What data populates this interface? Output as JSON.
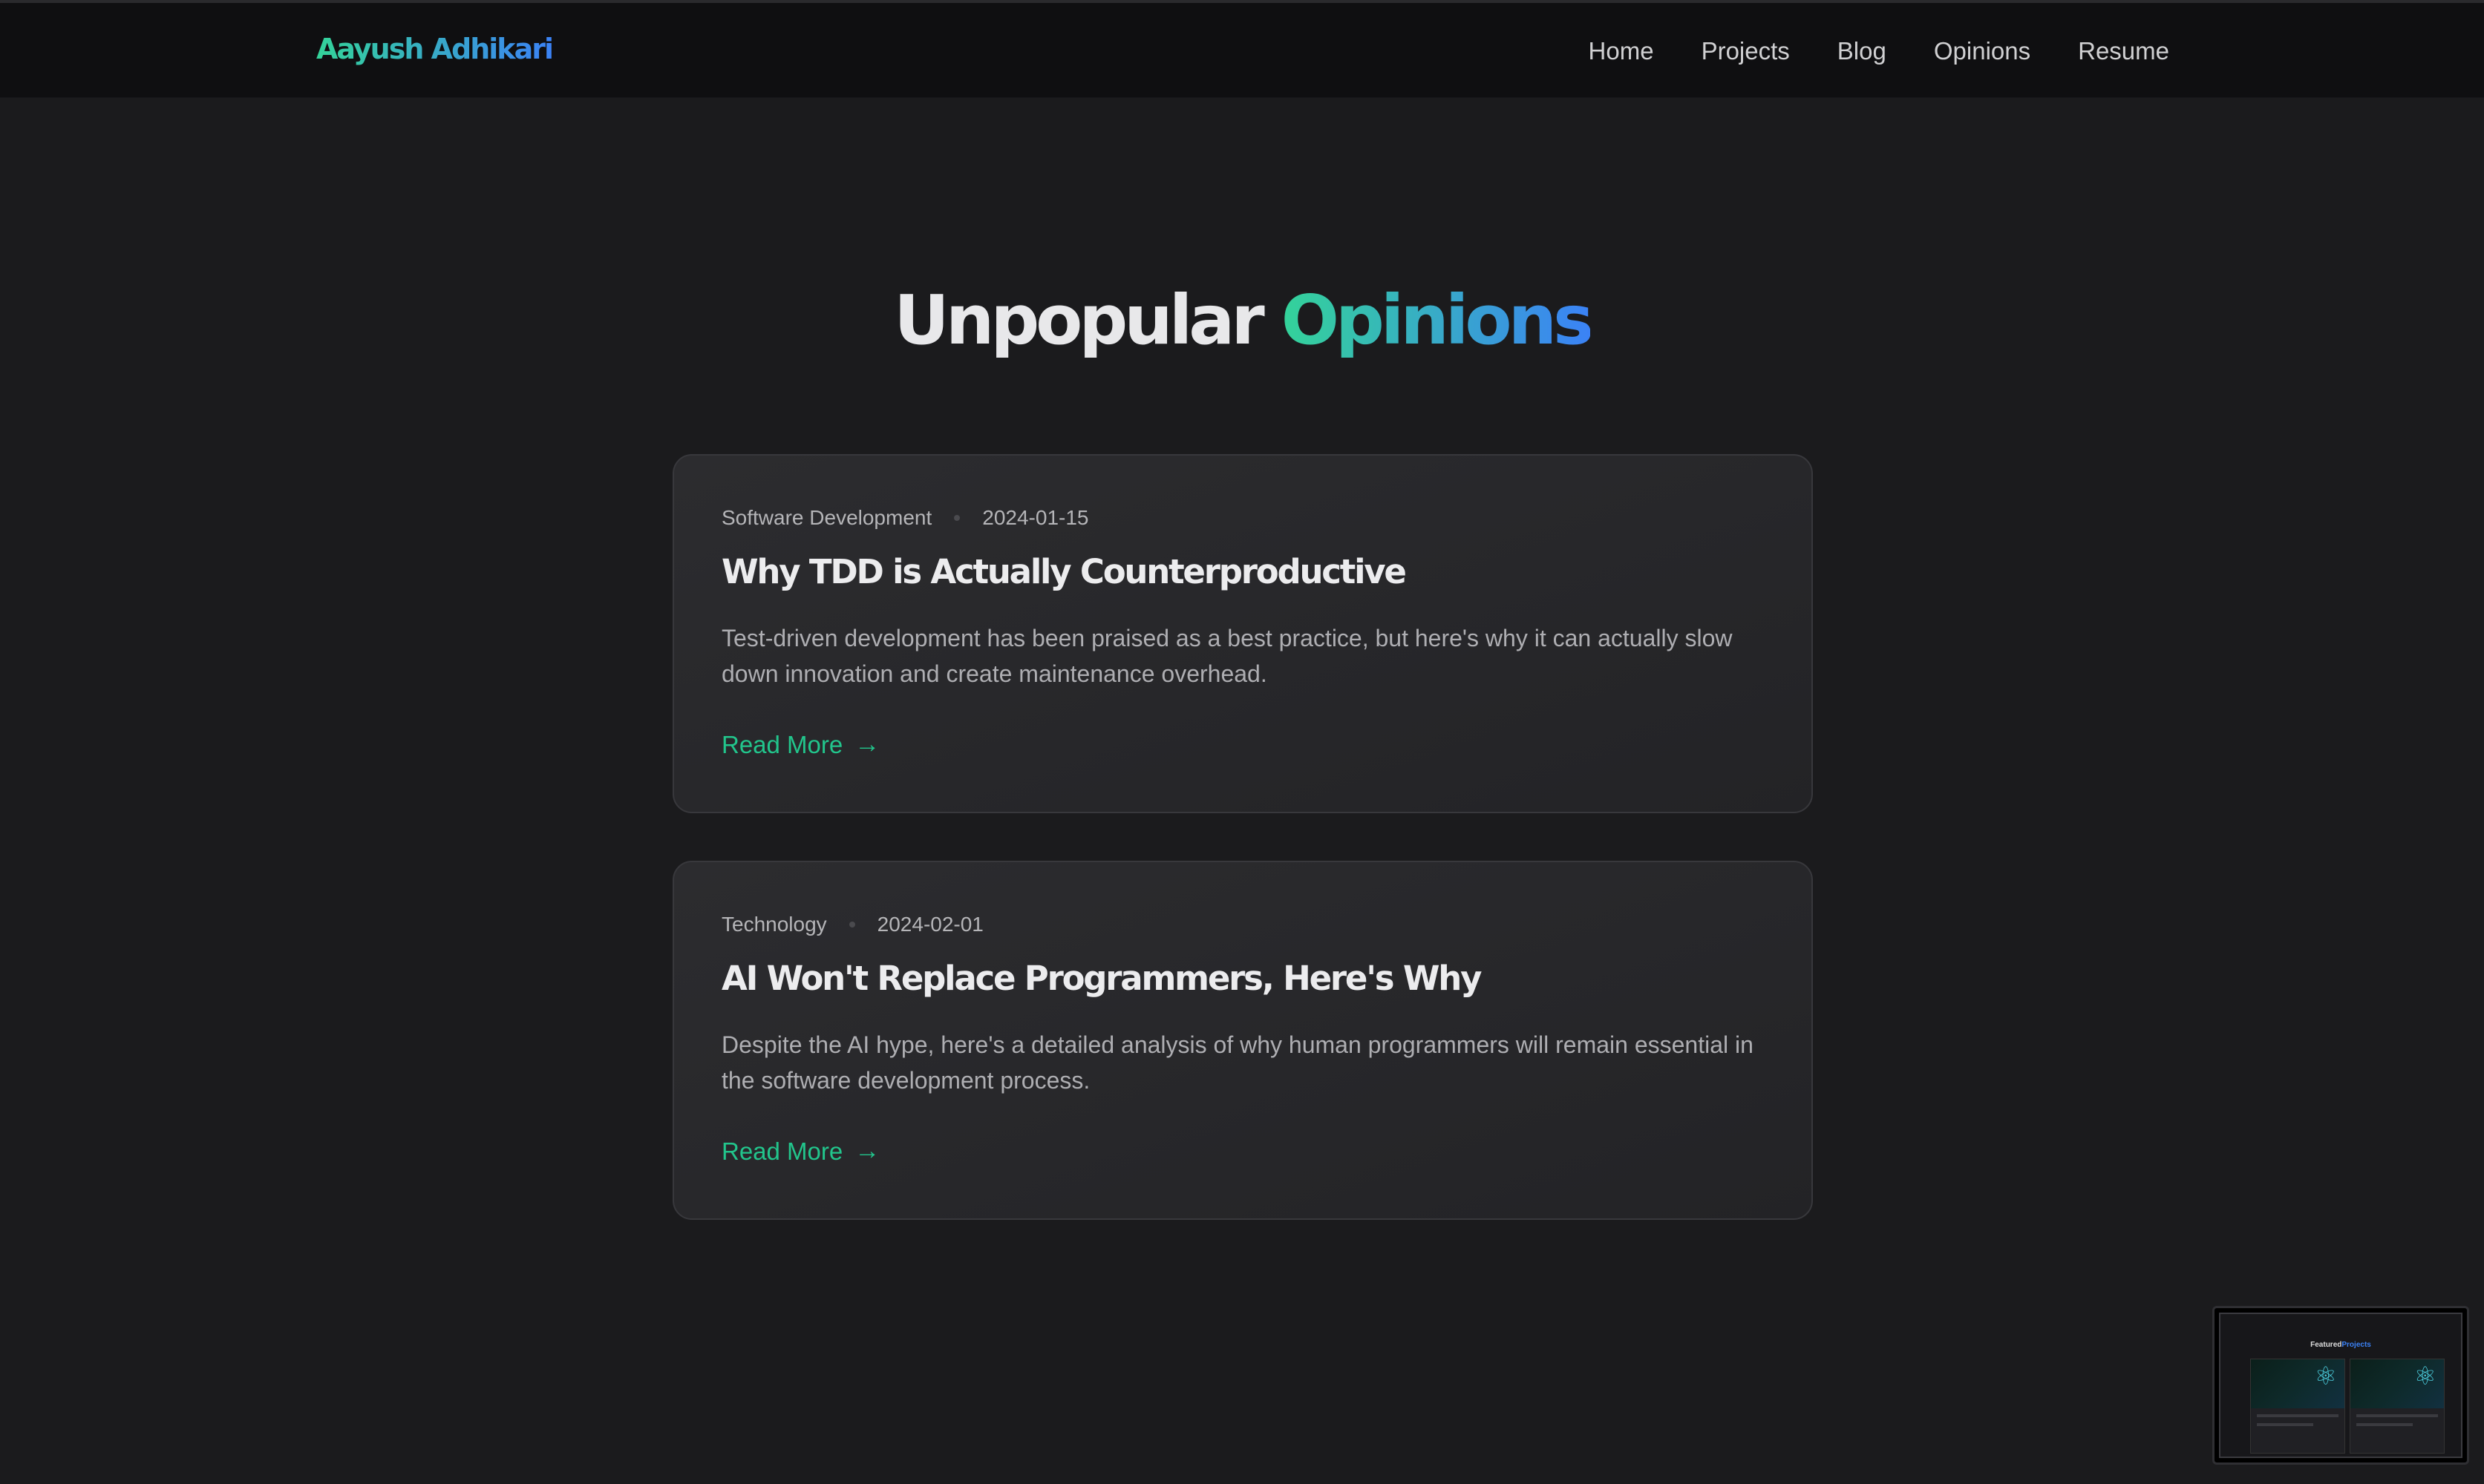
{
  "brand": {
    "name": "Aayush Adhikari"
  },
  "nav": {
    "items": [
      {
        "label": "Home"
      },
      {
        "label": "Projects"
      },
      {
        "label": "Blog"
      },
      {
        "label": "Opinions"
      },
      {
        "label": "Resume"
      }
    ]
  },
  "page": {
    "title_main": "Unpopular",
    "title_accent": "Opinions"
  },
  "posts": [
    {
      "category": "Software Development",
      "date": "2024-01-15",
      "title": "Why TDD is Actually Counterproductive",
      "excerpt": "Test-driven development has been praised as a best practice, but here's why it can actually slow down innovation and create maintenance overhead.",
      "read_more": "Read More",
      "arrow": "→"
    },
    {
      "category": "Technology",
      "date": "2024-02-01",
      "title": "AI Won't Replace Programmers, Here's Why",
      "excerpt": "Despite the AI hype, here's a detailed analysis of why human programmers will remain essential in the software development process.",
      "read_more": "Read More",
      "arrow": "→"
    }
  ],
  "preview_thumbnail": {
    "title_main": "Featured",
    "title_accent": "Projects",
    "icon": "react-icon"
  },
  "colors": {
    "background": "#1b1b1d",
    "navbar": "#0f0f11",
    "accent_green": "#34d399",
    "accent_blue": "#3b82f6",
    "link": "#22c58c"
  }
}
